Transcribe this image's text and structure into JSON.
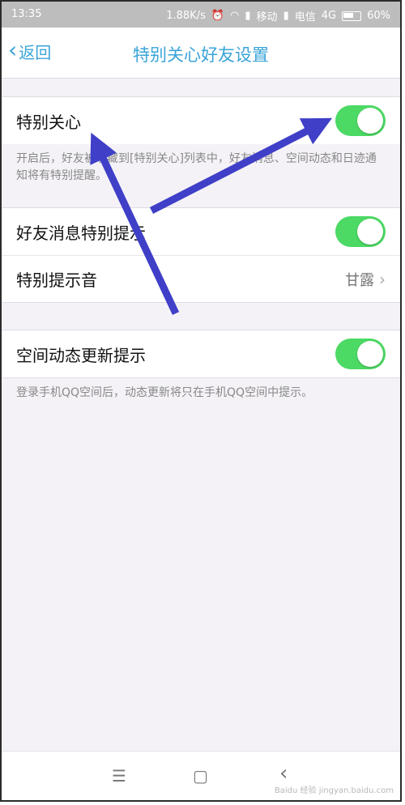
{
  "status": {
    "time": "13:35",
    "speed": "1.88K/s",
    "carrier1": "移动",
    "carrier2": "电信",
    "net": "4G",
    "battery": "60%"
  },
  "nav": {
    "back_label": "返回",
    "title": "特别关心好友设置"
  },
  "sections": {
    "special_care": {
      "label": "特别关心",
      "enabled": true,
      "description": "开启后，好友被收藏到[特别关心]列表中，好友消息、空间动态和日迹通知将有特别提醒。"
    },
    "friend_msg": {
      "label": "好友消息特别提示",
      "enabled": true
    },
    "sound": {
      "label": "特别提示音",
      "value": "甘露"
    },
    "qzone": {
      "label": "空间动态更新提示",
      "enabled": true,
      "description": "登录手机QQ空间后，动态更新将只在手机QQ空间中提示。"
    }
  },
  "bottom_nav": {
    "menu": "☰",
    "home": "▢",
    "back": "‹"
  },
  "watermark": "Baidu 经验 jingyan.baidu.com",
  "colors": {
    "accent": "#3aa4d8",
    "toggle_on": "#4cd964",
    "annotation_arrow": "#3f3fc8"
  }
}
